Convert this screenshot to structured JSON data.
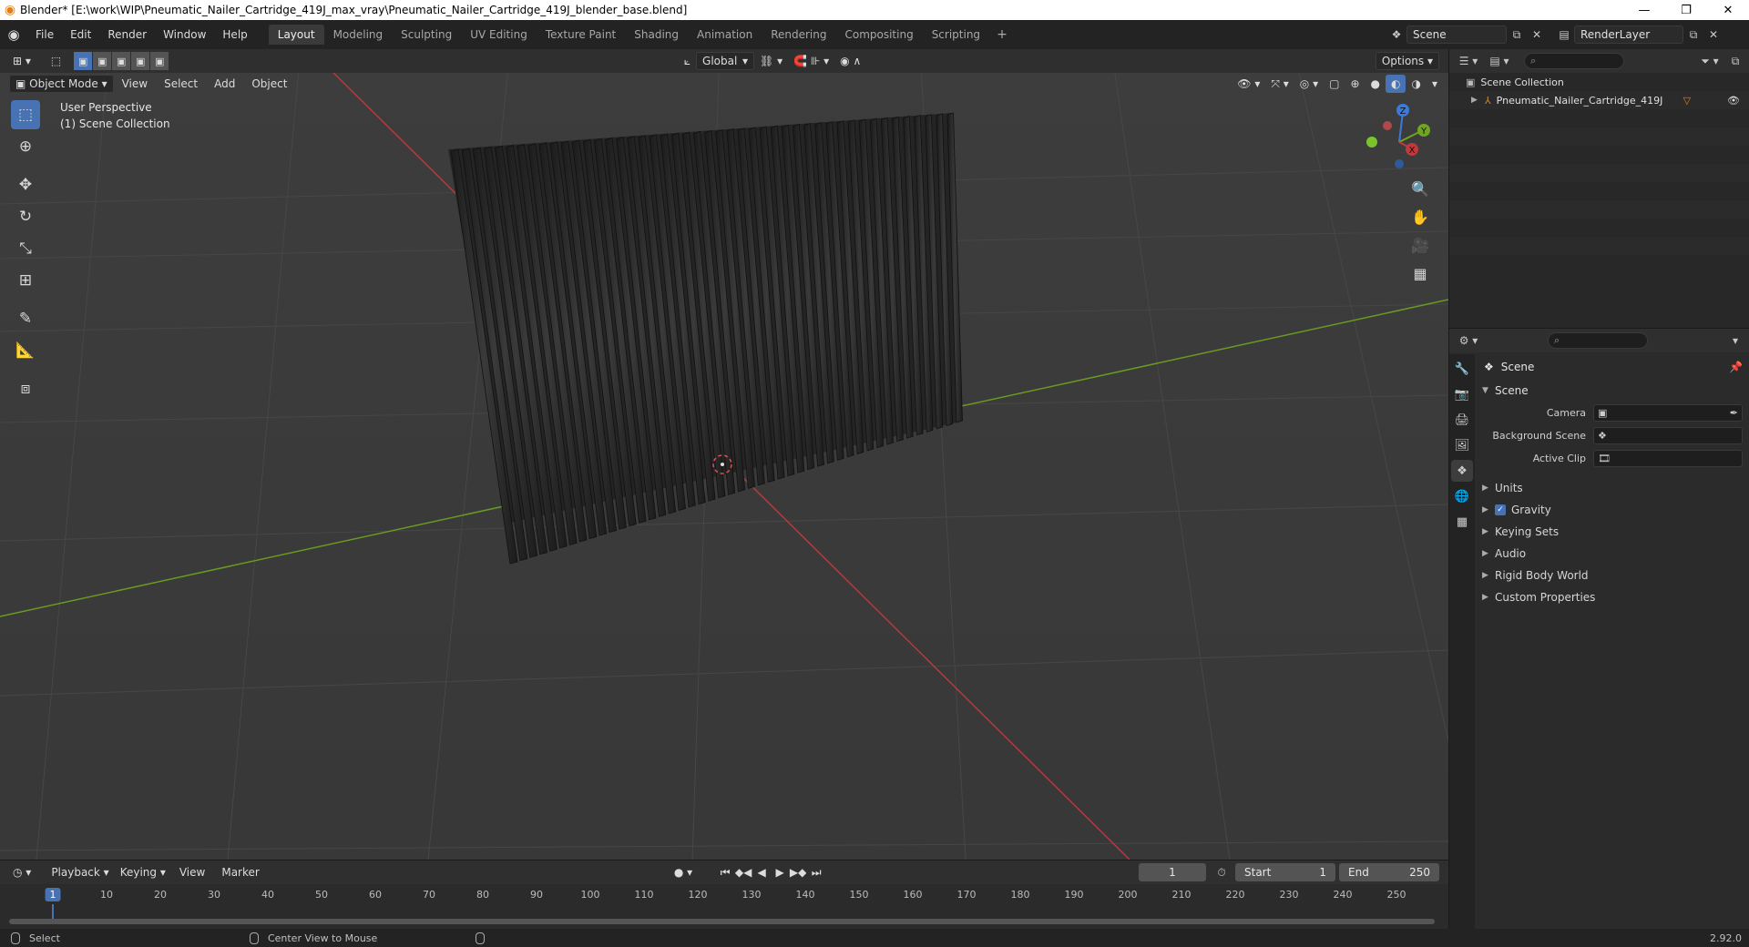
{
  "window": {
    "title": "Blender* [E:\\work\\WIP\\Pneumatic_Nailer_Cartridge_419J_max_vray\\Pneumatic_Nailer_Cartridge_419J_blender_base.blend]",
    "minimize": "—",
    "restore": "❐",
    "close": "✕"
  },
  "menu": {
    "items": [
      "File",
      "Edit",
      "Render",
      "Window",
      "Help"
    ]
  },
  "workspaces": [
    "Layout",
    "Modeling",
    "Sculpting",
    "UV Editing",
    "Texture Paint",
    "Shading",
    "Animation",
    "Rendering",
    "Compositing",
    "Scripting"
  ],
  "workspace_add": "+",
  "scene_name": "Scene",
  "view_layer": "RenderLayer",
  "viewport": {
    "mode": "Object Mode",
    "menus": [
      "View",
      "Select",
      "Add",
      "Object"
    ],
    "transform_orientation": "Global",
    "options_label": "Options",
    "perspective_text": "User Perspective",
    "collection_text": "(1) Scene Collection"
  },
  "gizmo": {
    "z": "Z",
    "y": "Y",
    "x": "X"
  },
  "outliner": {
    "root": "Scene Collection",
    "objects": [
      "Pneumatic_Nailer_Cartridge_419J"
    ]
  },
  "properties": {
    "title": "Scene",
    "section": "Scene",
    "fields": [
      {
        "label": "Camera",
        "value": ""
      },
      {
        "label": "Background Scene",
        "value": ""
      },
      {
        "label": "Active Clip",
        "value": ""
      }
    ],
    "subpanels": [
      "Units",
      "Gravity",
      "Keying Sets",
      "Audio",
      "Rigid Body World",
      "Custom Properties"
    ],
    "gravity_checked": true
  },
  "timeline": {
    "menus": [
      "Playback",
      "Keying",
      "View",
      "Marker"
    ],
    "current_frame": "1",
    "start_label": "Start",
    "start_value": "1",
    "end_label": "End",
    "end_value": "250",
    "ruler": [
      "10",
      "20",
      "30",
      "40",
      "50",
      "60",
      "70",
      "80",
      "90",
      "100",
      "110",
      "120",
      "130",
      "140",
      "150",
      "160",
      "170",
      "180",
      "190",
      "200",
      "210",
      "220",
      "230",
      "240",
      "250"
    ]
  },
  "status": {
    "select": "Select",
    "center_view": "Center View to Mouse",
    "version": "2.92.0"
  },
  "colors": {
    "accent": "#4772b3",
    "x_axis": "#c0393c",
    "y_axis": "#6fa520",
    "z_axis": "#3b7adb"
  }
}
